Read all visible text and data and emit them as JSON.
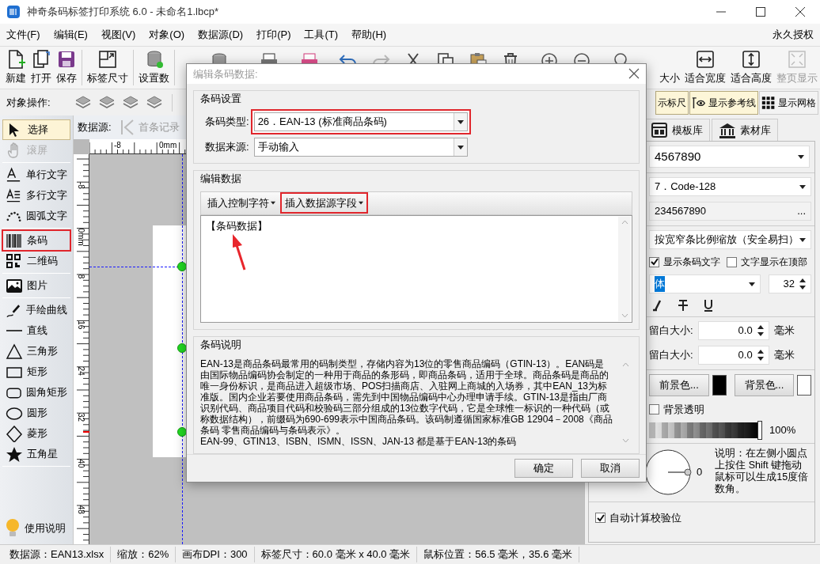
{
  "window": {
    "title": "神奇条码标签打印系统 6.0 - 未命名1.lbcp*"
  },
  "menu": [
    "文件(F)",
    "编辑(E)",
    "视图(V)",
    "对象(O)",
    "数据源(D)",
    "打印(P)",
    "工具(T)",
    "帮助(H)"
  ],
  "license": "永久授权",
  "toolbar_left": [
    {
      "label": "新建",
      "disabled": false
    },
    {
      "label": "打开",
      "disabled": false
    },
    {
      "label": "保存",
      "disabled": false
    },
    {
      "label": "标签尺寸",
      "disabled": false
    },
    {
      "label": "设置数",
      "disabled": false
    }
  ],
  "toolbar_right": [
    {
      "label": "大小",
      "disabled": false
    },
    {
      "label": "适合宽度",
      "disabled": false
    },
    {
      "label": "适合高度",
      "disabled": false
    },
    {
      "label": "整页显示",
      "disabled": true
    }
  ],
  "object_toolbar": {
    "label": "对象操作:",
    "toggles": [
      {
        "label": "示标尺",
        "on": true
      },
      {
        "label": "显示参考线",
        "on": true
      },
      {
        "label": "显示网格",
        "on": false
      }
    ]
  },
  "tool_groups": [
    [
      {
        "label": "选择",
        "selected": true,
        "disabled": false,
        "highlighted": false
      },
      {
        "label": "滚屏",
        "selected": false,
        "disabled": true,
        "highlighted": false
      }
    ],
    [
      {
        "label": "单行文字",
        "selected": false,
        "disabled": false,
        "highlighted": false
      },
      {
        "label": "多行文字",
        "selected": false,
        "disabled": false,
        "highlighted": false
      },
      {
        "label": "圆弧文字",
        "selected": false,
        "disabled": false,
        "highlighted": false
      }
    ],
    [
      {
        "label": "条码",
        "selected": false,
        "disabled": false,
        "highlighted": true
      },
      {
        "label": "二维码",
        "selected": false,
        "disabled": false,
        "highlighted": false
      }
    ],
    [
      {
        "label": "图片",
        "selected": false,
        "disabled": false,
        "highlighted": false
      }
    ],
    [
      {
        "label": "手绘曲线",
        "selected": false,
        "disabled": false,
        "highlighted": false
      },
      {
        "label": "直线",
        "selected": false,
        "disabled": false,
        "highlighted": false
      },
      {
        "label": "三角形",
        "selected": false,
        "disabled": false,
        "highlighted": false
      },
      {
        "label": "矩形",
        "selected": false,
        "disabled": false,
        "highlighted": false
      },
      {
        "label": "圆角矩形",
        "selected": false,
        "disabled": false,
        "highlighted": false
      },
      {
        "label": "圆形",
        "selected": false,
        "disabled": false,
        "highlighted": false
      },
      {
        "label": "菱形",
        "selected": false,
        "disabled": false,
        "highlighted": false
      },
      {
        "label": "五角星",
        "selected": false,
        "disabled": false,
        "highlighted": false
      }
    ]
  ],
  "help": "使用说明",
  "datasource_bar": {
    "label": "数据源:",
    "first_record": {
      "label": "首条记录",
      "disabled": true
    }
  },
  "ruler": {
    "horizontal": [
      "-8",
      "0mm"
    ],
    "vertical": [
      "-8",
      "0mm",
      "8",
      "16",
      "24",
      "32",
      "40",
      "48"
    ]
  },
  "right_panel": {
    "tabs": [
      {
        "label": "模板库",
        "selected": false
      },
      {
        "label": "素材库",
        "selected": false
      }
    ],
    "barcode_value": "4567890",
    "barcode_type": "7．Code-128",
    "data": "234567890",
    "data_button": "...",
    "scale_mode": "按宽窄条比例缩放（安全易扫）",
    "show_text": {
      "label": "显示条码文字",
      "checked": true
    },
    "text_on_top": {
      "label": "文字显示在顶部",
      "checked": false
    },
    "font": "体",
    "font_size": "32",
    "margins": [
      {
        "label": "留白大小:",
        "value": "0.0",
        "unit": "毫米"
      },
      {
        "label": "留白大小:",
        "value": "0.0",
        "unit": "毫米"
      }
    ],
    "foreground": {
      "label": "前景色...",
      "color": "#000000"
    },
    "background": {
      "label": "背景色...",
      "color": "#ffffff"
    },
    "transparent": {
      "label": "背景透明",
      "checked": false
    },
    "opacity": {
      "level": 1,
      "reading": "100%"
    },
    "rotation": {
      "reading": "0"
    },
    "rotation_help": "说明：在左侧小圆点上按住 Shift 键拖动鼠标可以生成15度倍数角。",
    "auto_check": {
      "label": "自动计算校验位",
      "checked": true
    }
  },
  "dialog": {
    "title": "编辑条码数据:",
    "settings": {
      "title": "条码设置",
      "fields": [
        {
          "label": "条码类型:",
          "value": "26．EAN-13 (标准商品条码)",
          "highlighted": true
        },
        {
          "label": "数据来源:",
          "value": "手动输入",
          "highlighted": false
        }
      ]
    },
    "edit": {
      "title": "编辑数据",
      "buttons": [
        {
          "label": "插入控制字符",
          "highlighted": false
        },
        {
          "label": "插入数据源字段",
          "highlighted": true
        }
      ],
      "content": "【条码数据】"
    },
    "description": {
      "title": "条码说明",
      "paragraphs": [
        "EAN-13是商品条码最常用的码制类型，存储内容为13位的零售商品编码（GTIN-13）。EAN码是由国际物品编码协会制定的一种用于商品的条形码，即商品条码，适用于全球。商品条码是商品的唯一身份标识，是商品进入超级市场、POS扫描商店、入驻网上商城的入场券，其中EAN_13为标准版。国内企业若要使用商品条码，需先到中国物品编码中心办理申请手续。GTIN-13是指由厂商识别代码、商品项目代码和校验码三部分组成的13位数字代码，它是全球惟一标识的一种代码（或称数据结构），前缀码为690-699表示中国商品条码。该码制遵循国家标准GB 12904－2008《商品条码 零售商品编码与条码表示》。",
        "EAN-99、GTIN13、ISBN、ISMN、ISSN、JAN-13 都是基于EAN-13的条码"
      ]
    },
    "buttons": [
      "确定",
      "取消"
    ]
  },
  "status_bar": [
    "数据源：EAN13.xlsx",
    "缩放：62%",
    "画布DPI：300",
    "标签尺寸：60.0 毫米 x 40.0 毫米",
    "鼠标位置：56.5 毫米，35.6 毫米"
  ]
}
